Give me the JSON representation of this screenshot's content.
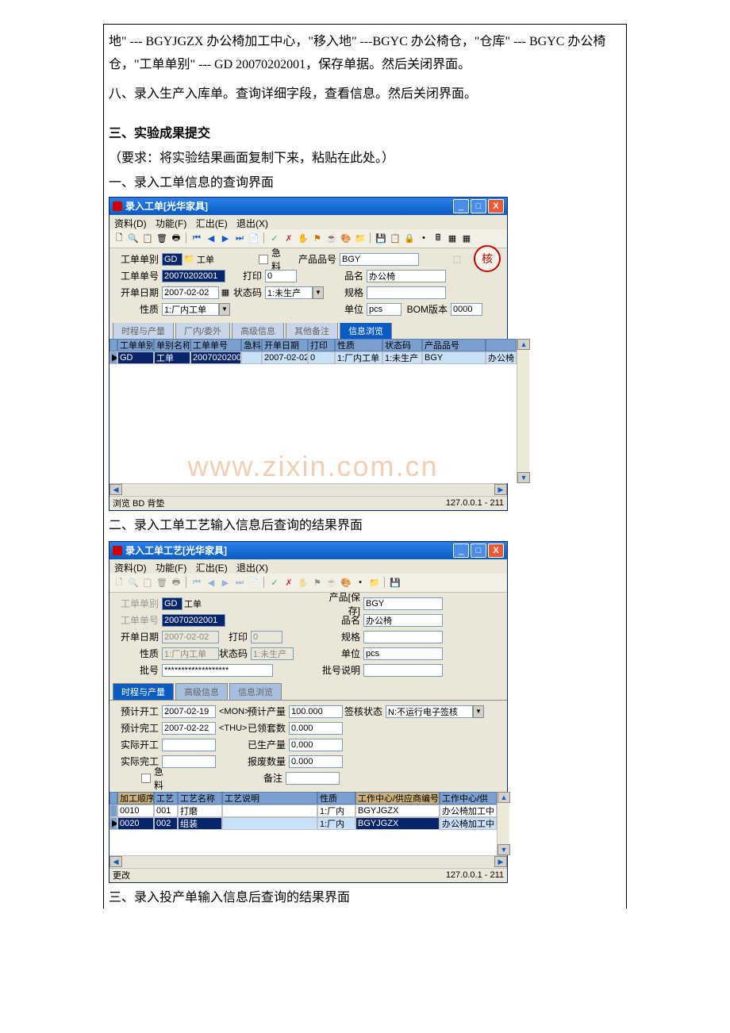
{
  "para1": "地\" --- BGYJGZX 办公椅加工中心，\"移入地\" ---BGYC 办公椅仓，\"仓库\" --- BGYC 办公椅仓，\"工单单别\" --- GD 20070202001，保存单据。然后关闭界面。",
  "para2": "八、录入生产入库单。查询详细字段，查看信息。然后关闭界面。",
  "section3_title": "三、实验成果提交",
  "section3_req": "（要求：将实验结果画面复制下来，粘贴在此处。）",
  "cap1": "一、录入工单信息的查询界面",
  "cap2": "二、录入工单工艺输入信息后查询的结果界面",
  "cap3": "三、录入投产单输入信息后查询的结果界面",
  "win1": {
    "title": "录入工单[光华家具]",
    "menu": [
      "资料(D)",
      "功能(F)",
      "汇出(E)",
      "退出(X)"
    ],
    "labels": {
      "gdlb": "工单单别",
      "gdlb_v": "GD",
      "gdlb_v2": "工单",
      "jl": "急料",
      "cpph": "产品品号",
      "cpph_v": "BGY",
      "gddh": "工单单号",
      "gddh_v": "20070202001",
      "dy": "打印",
      "dy_v": "0",
      "pm": "品名",
      "pm_v": "办公椅",
      "kdrq": "开单日期",
      "kdrq_v": "2007-02-02",
      "ztm": "状态码",
      "ztm_v": "1:未生产",
      "gg": "规格",
      "xz": "性质",
      "xz_v": "1:厂内工单",
      "dw": "单位",
      "dw_v": "pcs",
      "bom": "BOM版本",
      "bom_v": "0000"
    },
    "tabs": [
      "时程与产量",
      "厂内/委外",
      "高级信息",
      "其他备注",
      "信息浏览"
    ],
    "grid_hdr": [
      "工单单别",
      "单别名称",
      "工单单号",
      "急料",
      "开单日期",
      "打印",
      "性质",
      "状态码",
      "产品品号",
      ""
    ],
    "grid_row": [
      "GD",
      "工单",
      "20070202001",
      "",
      "2007-02-02",
      "0",
      "1:厂内工单",
      "1:未生产",
      "BGY",
      "办公椅"
    ],
    "watermark": "www.zixin.com.cn",
    "status_l": "浏览  BD 背垫",
    "status_r": "127.0.0.1 - 211"
  },
  "win2": {
    "title": "录入工单工艺[光华家具]",
    "menu": [
      "资料(D)",
      "功能(F)",
      "汇出(E)",
      "退出(X)"
    ],
    "labels": {
      "gdlb": "工单单别",
      "gdlb_v": "GD",
      "gdlb_v2": "工单",
      "cppl": "产品[保存]",
      "cppl_v": "BGY",
      "gddh": "工单单号",
      "gddh_v": "20070202001",
      "pm": "品名",
      "pm_v": "办公椅",
      "kdrq": "开单日期",
      "kdrq_v": "2007-02-02",
      "dy": "打印",
      "dy_v": "0",
      "gg": "规格",
      "xz": "性质",
      "xz_v": "1:厂内工单",
      "ztm": "状态码",
      "ztm_v": "1:未生产",
      "dw": "单位",
      "dw_v": "pcs",
      "ph": "批号",
      "ph_v": "*******************",
      "phsm": "批号说明"
    },
    "tabs": [
      "时程与产量",
      "高级信息",
      "信息浏览"
    ],
    "sched": {
      "yjkg": "预计开工",
      "yjkg_v": "2007-02-19",
      "yjkg_d": "<MON>",
      "yjcl": "预计产量",
      "yjcl_v": "100.000",
      "qhzt": "签核状态",
      "qhzt_v": "N:不运行电子签核",
      "yjwg": "预计完工",
      "yjwg_v": "2007-02-22",
      "yjwg_d": "<THU>",
      "ylts": "已领套数",
      "ylts_v": "0.000",
      "sjkg": "实际开工",
      "ysc": "已生产量",
      "ysc_v": "0.000",
      "sjwg": "实际完工",
      "bfsl": "报废数量",
      "bfsl_v": "0.000",
      "jl": "急料",
      "bz": "备注"
    },
    "grid_hdr": [
      "加工顺序",
      "工艺",
      "工艺名称",
      "工艺说明",
      "性质",
      "工作中心/供应商编号",
      "工作中心/供"
    ],
    "grid_rows": [
      [
        "0010",
        "001",
        "打磨",
        "",
        "1:厂内",
        "BGYJGZX",
        "办公椅加工中"
      ],
      [
        "0020",
        "002",
        "组装",
        "",
        "1:厂内",
        "BGYJGZX",
        "办公椅加工中"
      ]
    ],
    "status_l": "更改",
    "status_r": "127.0.0.1 - 211"
  }
}
